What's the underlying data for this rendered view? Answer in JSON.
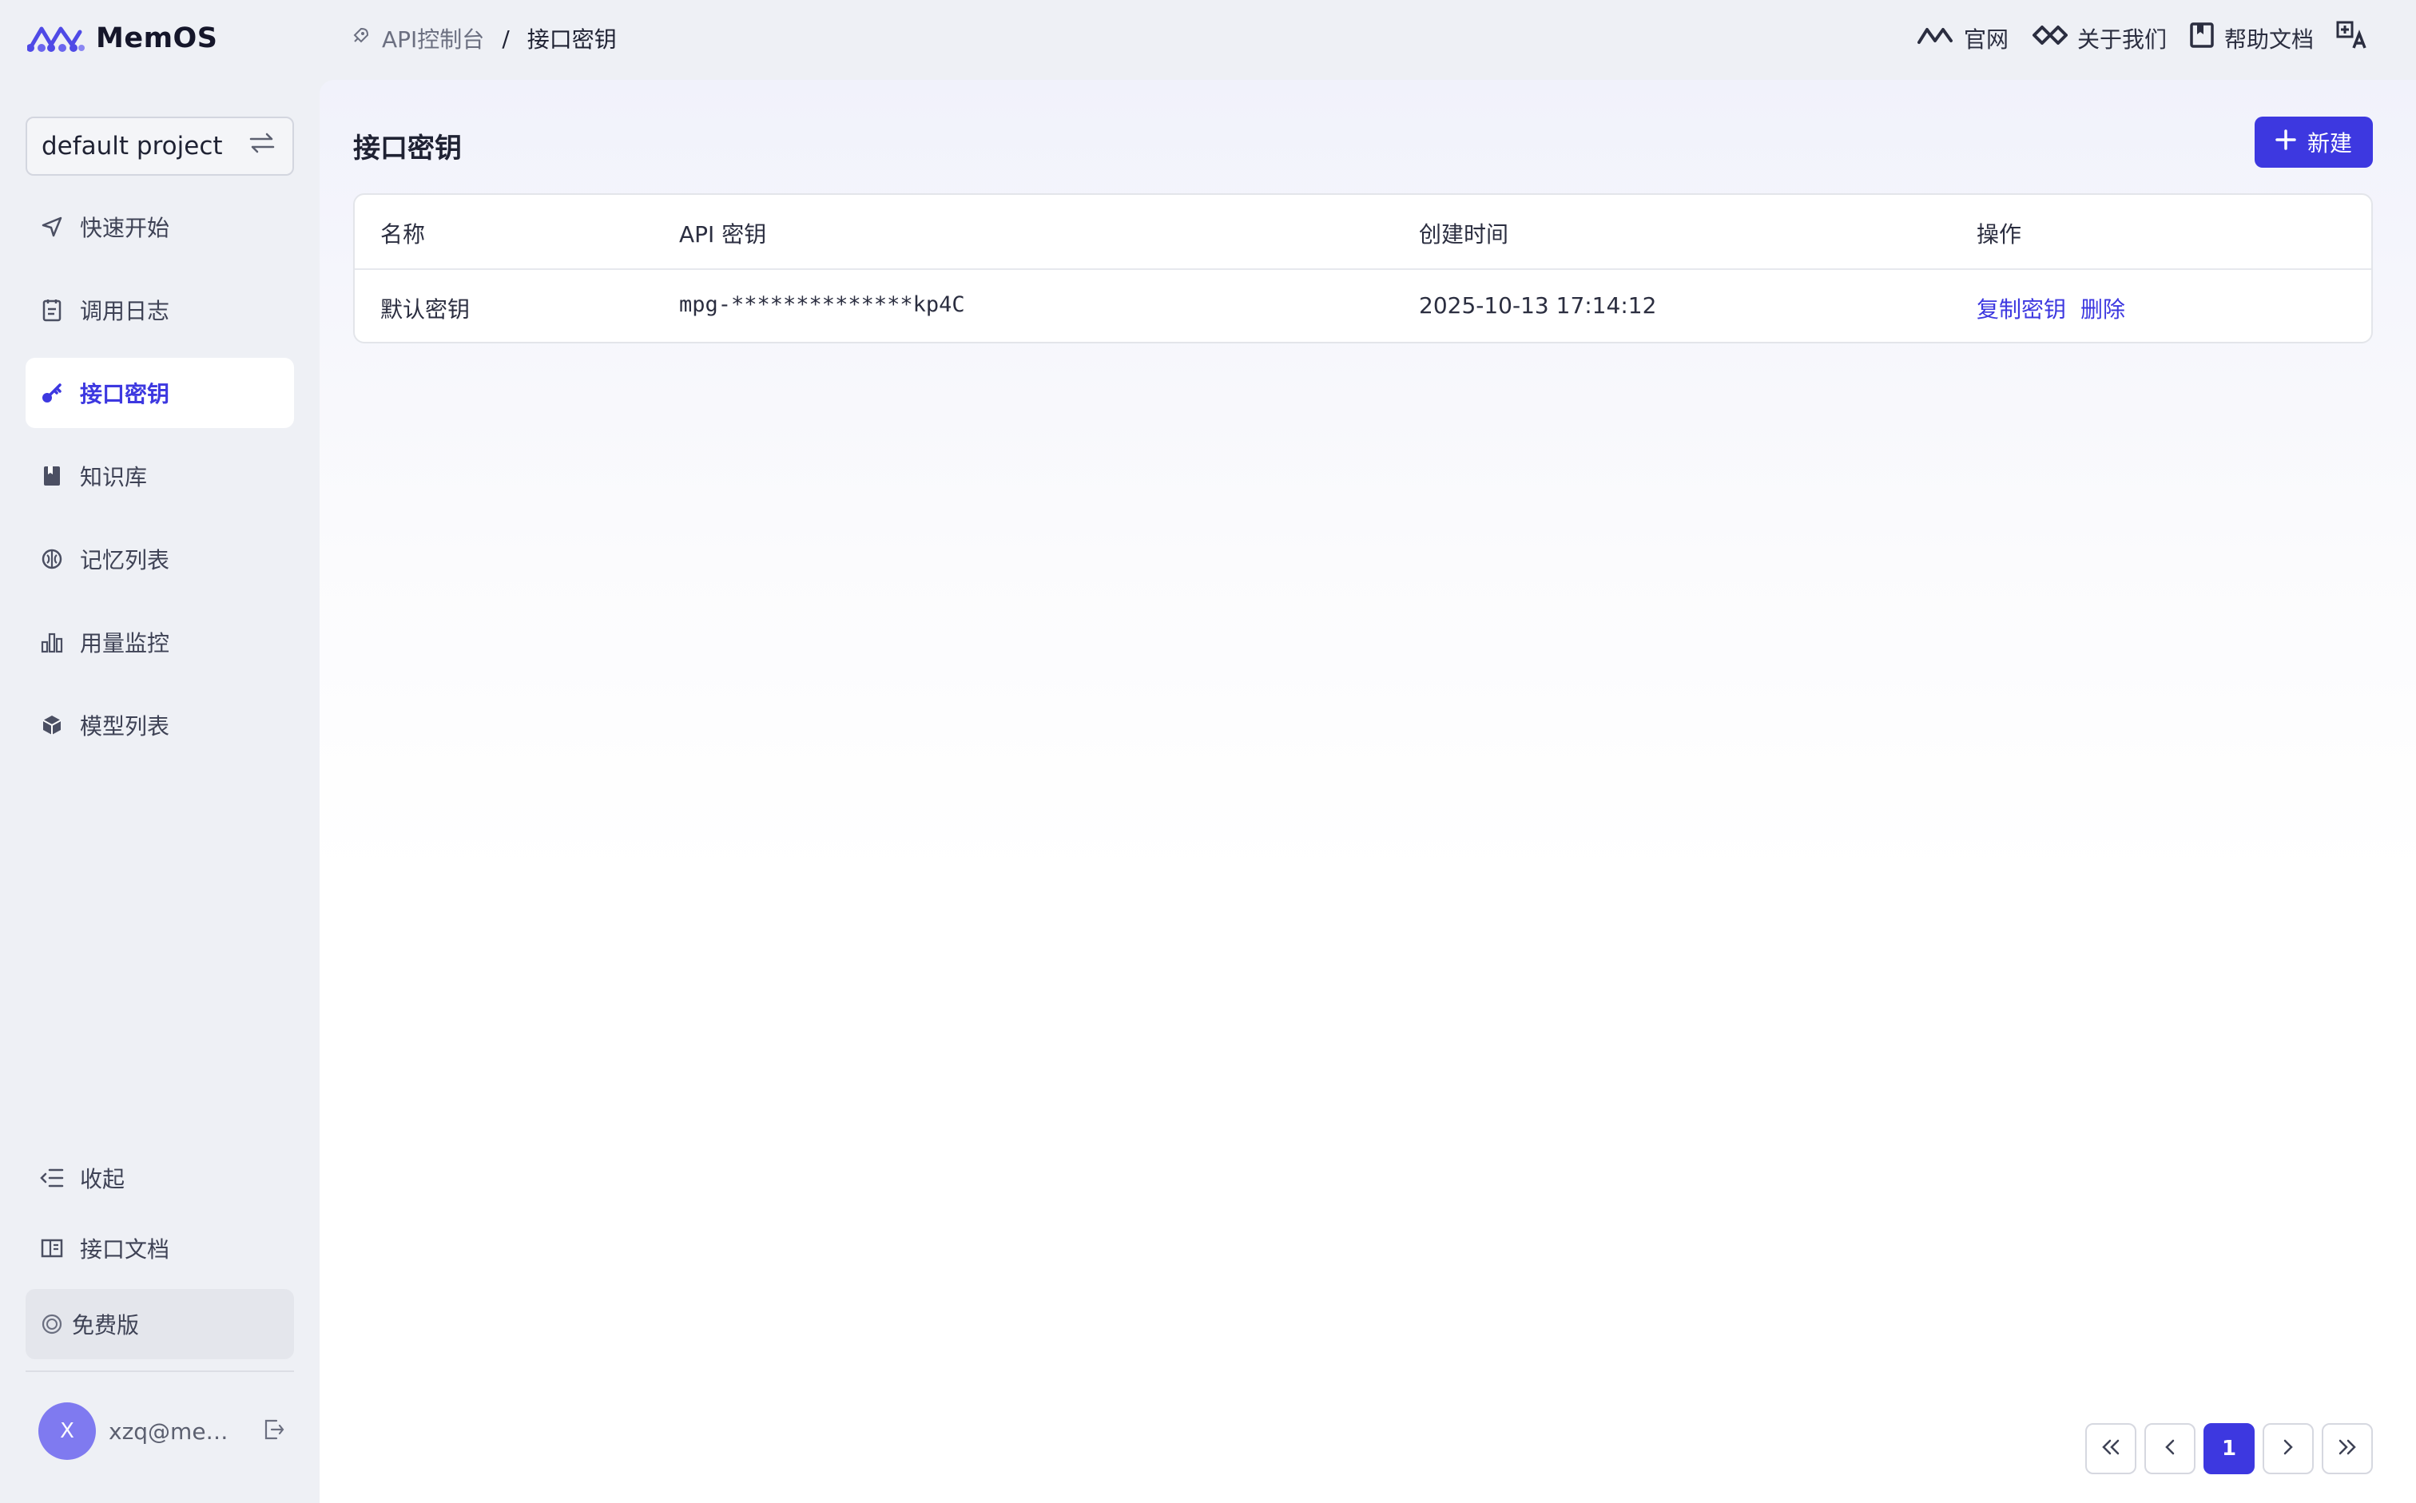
{
  "brand": {
    "name": "MemOS"
  },
  "breadcrumb": {
    "parent": "API控制台",
    "separator": "/",
    "current": "接口密钥"
  },
  "top_links": {
    "official_site": "官网",
    "about_us": "关于我们",
    "help_docs": "帮助文档"
  },
  "sidebar": {
    "project": "default project",
    "items": [
      {
        "label": "快速开始",
        "icon": "send-icon"
      },
      {
        "label": "调用日志",
        "icon": "clipboard-icon"
      },
      {
        "label": "接口密钥",
        "icon": "key-icon",
        "active": true
      },
      {
        "label": "知识库",
        "icon": "book-icon"
      },
      {
        "label": "记忆列表",
        "icon": "brain-icon"
      },
      {
        "label": "用量监控",
        "icon": "bar-chart-icon"
      },
      {
        "label": "模型列表",
        "icon": "cube-icon"
      }
    ],
    "collapse": "收起",
    "api_docs": "接口文档",
    "plan": "免费版",
    "user": {
      "avatar_letter": "X",
      "email": "xzq@memt..."
    }
  },
  "main": {
    "title": "接口密钥",
    "new_button": "新建",
    "table": {
      "headers": {
        "name": "名称",
        "key": "API 密钥",
        "created": "创建时间",
        "ops": "操作"
      },
      "rows": [
        {
          "name": "默认密钥",
          "key": "mpg-**************kp4C",
          "created": "2025-10-13 17:14:12",
          "copy": "复制密钥",
          "delete": "删除"
        }
      ]
    },
    "pagination": {
      "current": "1"
    }
  },
  "colors": {
    "accent": "#3d38e0",
    "avatar": "#7f7af0",
    "text": "#1f2233"
  }
}
